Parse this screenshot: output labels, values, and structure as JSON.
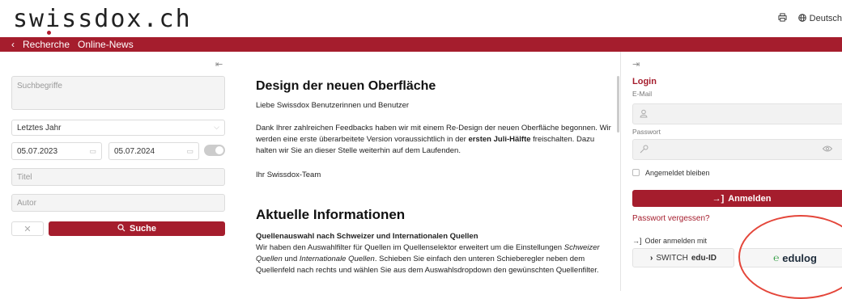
{
  "brand": {
    "logo": "swissdox.ch"
  },
  "header": {
    "print_icon": "printer-icon",
    "language_icon": "globe-icon",
    "language": "Deutsch"
  },
  "nav": {
    "back_icon": "chevron-left-icon",
    "items": [
      "Recherche",
      "Online-News"
    ]
  },
  "search": {
    "keywords_placeholder": "Suchbegriffe",
    "period": "Letztes Jahr",
    "date_from": "05.07.2023",
    "date_to": "05.07.2024",
    "title_placeholder": "Titel",
    "author_placeholder": "Autor",
    "clear_label": "✕",
    "search_label": "Suche"
  },
  "news": {
    "heading1": "Design der neuen Oberfläche",
    "greeting": "Liebe Swissdox Benutzerinnen und Benutzer",
    "para1_a": "Dank Ihrer zahlreichen Feedbacks haben wir mit einem Re-Design der neuen Oberfläche begonnen. Wir  werden eine erste überarbeitete Version voraussichtlich in der ",
    "para1_bold": "ersten Juli-Hälfte",
    "para1_b": " freischalten. Dazu halten wir Sie an dieser Stelle weiterhin auf dem Laufenden.",
    "signature": "Ihr Swissdox-Team",
    "heading2": "Aktuelle Informationen",
    "subheading": "Quellenauswahl nach Schweizer und Internationalen Quellen",
    "para2_a": "Wir haben den Auswahlfilter für Quellen im Quellenselektor erweitert um die Einstellungen ",
    "para2_i1": "Schweizer Quellen",
    "para2_b": " und ",
    "para2_i2": "Internationale Quellen",
    "para2_c": ". Schieben Sie einfach den unteren Schieberegler neben dem Quellenfeld nach rechts und wählen Sie aus dem Auswahlsdropdown den gewünschten Quellenfilter."
  },
  "login": {
    "title": "Login",
    "email_label": "E-Mail",
    "password_label": "Passwort",
    "remember_label": "Angemeldet bleiben",
    "submit_label": "Anmelden",
    "forgot_label": "Passwort vergessen?",
    "alt_label": "Oder anmelden mit",
    "switch_label_a": "SWITCH",
    "switch_label_b": "edu-ID",
    "edulog_label": "edulog"
  },
  "colors": {
    "brand_red": "#a51d2d",
    "highlight_red": "#e4463a"
  }
}
